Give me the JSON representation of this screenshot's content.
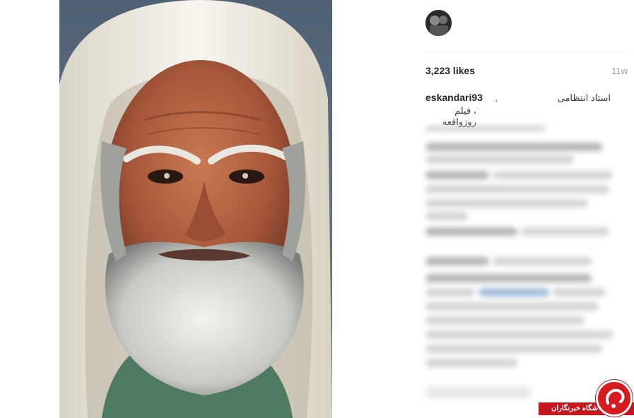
{
  "post": {
    "likes": "3,223 likes",
    "age": "11w",
    "username": "eskandari93",
    "caption_separator": "،",
    "caption_line1": "استاد انتظامی",
    "caption_line2": "، فیلم روزواقعه"
  },
  "watermark": {
    "label": "باشگاه خبرنگاران"
  },
  "colors": {
    "background": "#ffffff",
    "divider": "#efefef",
    "muted_text": "#a0a0a0",
    "brand_red": "#c5161d"
  }
}
